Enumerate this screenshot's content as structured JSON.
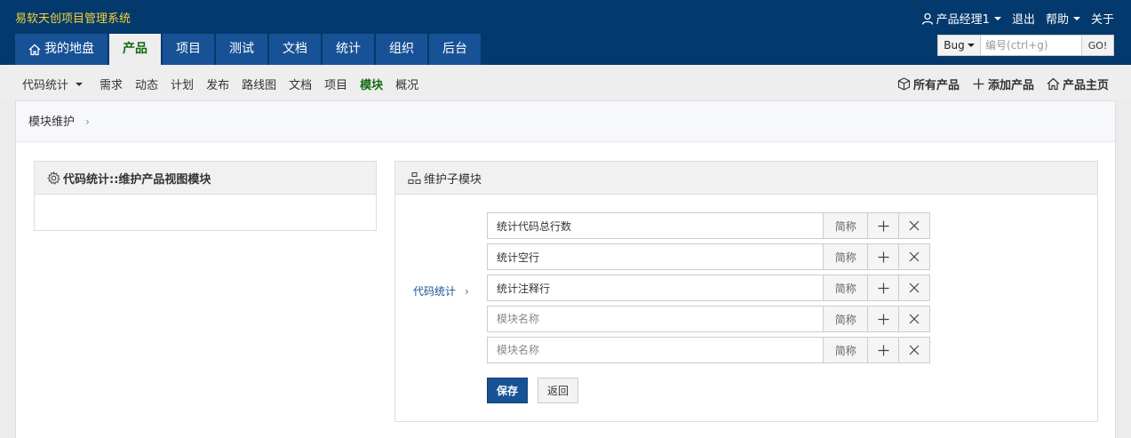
{
  "app": {
    "title": "易软天创项目管理系统"
  },
  "user_menu": {
    "user": "产品经理1",
    "logout": "退出",
    "help": "帮助",
    "about": "关于"
  },
  "main_nav": [
    {
      "label": "我的地盘",
      "icon": "home-icon"
    },
    {
      "label": "产品",
      "active": true
    },
    {
      "label": "项目"
    },
    {
      "label": "测试"
    },
    {
      "label": "文档"
    },
    {
      "label": "统计"
    },
    {
      "label": "组织"
    },
    {
      "label": "后台"
    }
  ],
  "search": {
    "type": "Bug",
    "placeholder": "编号(ctrl+g)",
    "go": "GO!"
  },
  "sub_nav": {
    "product_switcher": "代码统计",
    "items": [
      "需求",
      "动态",
      "计划",
      "发布",
      "路线图",
      "文档",
      "项目",
      "模块",
      "概况"
    ],
    "active": "模块",
    "right": [
      {
        "label": "所有产品",
        "icon": "cube-icon"
      },
      {
        "label": "添加产品",
        "icon": "plus-icon"
      },
      {
        "label": "产品主页",
        "icon": "home-icon"
      }
    ]
  },
  "breadcrumb": {
    "label": "模块维护",
    "sep": "›"
  },
  "left_panel": {
    "title": "代码统计::维护产品视图模块",
    "icon": "gear-icon"
  },
  "right_panel": {
    "title": "维护子模块",
    "icon": "sitemap-icon"
  },
  "parent": {
    "label": "代码统计",
    "sep": "›"
  },
  "modules": [
    {
      "value": "统计代码总行数",
      "placeholder": "模块名称",
      "short": "简称"
    },
    {
      "value": "统计空行",
      "placeholder": "模块名称",
      "short": "简称"
    },
    {
      "value": "统计注释行",
      "placeholder": "模块名称",
      "short": "简称"
    },
    {
      "value": "",
      "placeholder": "模块名称",
      "short": "简称"
    },
    {
      "value": "",
      "placeholder": "模块名称",
      "short": "简称"
    }
  ],
  "actions": {
    "save": "保存",
    "back": "返回"
  },
  "colors": {
    "header": "#03396c",
    "tab": "#185296",
    "active_text": "#146a14",
    "title": "#f5d23a"
  }
}
